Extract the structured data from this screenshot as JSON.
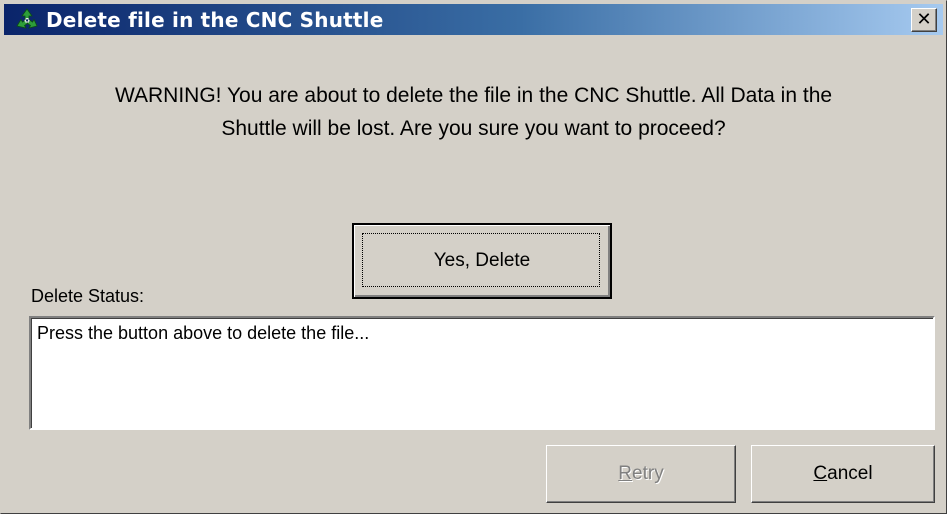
{
  "window": {
    "title": "Delete file in the CNC Shuttle",
    "icon": "recycle-icon",
    "close_glyph": "✕"
  },
  "dialog": {
    "warning_line1": "WARNING! You are about to delete the file in the CNC Shuttle.  All Data in the",
    "warning_line2": "Shuttle will be lost.  Are you sure you want to proceed?",
    "delete_button_label": "Yes, Delete",
    "status_label": "Delete Status:",
    "status_text": "Press the button above to delete the file...",
    "retry_button": {
      "mnemonic": "R",
      "rest": "etry",
      "enabled": false
    },
    "cancel_button": {
      "mnemonic": "C",
      "rest": "ancel",
      "enabled": true
    }
  },
  "colors": {
    "face": "#d4d0c8",
    "title_start": "#0a246a",
    "title_end": "#a6caf0",
    "recycle_green": "#2e9e3a"
  }
}
